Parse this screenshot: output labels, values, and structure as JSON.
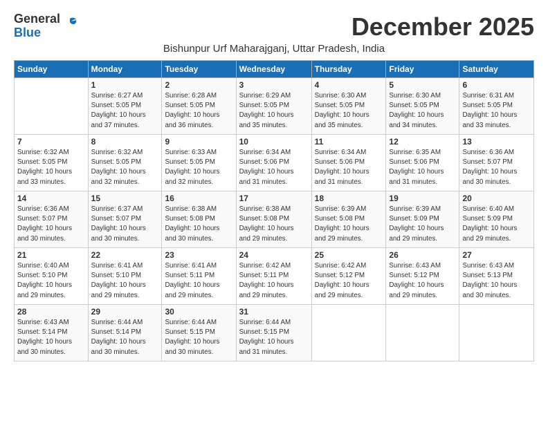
{
  "logo": {
    "general": "General",
    "blue": "Blue"
  },
  "title": "December 2025",
  "subtitle": "Bishunpur Urf Maharajganj, Uttar Pradesh, India",
  "days_header": [
    "Sunday",
    "Monday",
    "Tuesday",
    "Wednesday",
    "Thursday",
    "Friday",
    "Saturday"
  ],
  "weeks": [
    [
      {
        "num": "",
        "info": ""
      },
      {
        "num": "1",
        "info": "Sunrise: 6:27 AM\nSunset: 5:05 PM\nDaylight: 10 hours\nand 37 minutes."
      },
      {
        "num": "2",
        "info": "Sunrise: 6:28 AM\nSunset: 5:05 PM\nDaylight: 10 hours\nand 36 minutes."
      },
      {
        "num": "3",
        "info": "Sunrise: 6:29 AM\nSunset: 5:05 PM\nDaylight: 10 hours\nand 35 minutes."
      },
      {
        "num": "4",
        "info": "Sunrise: 6:30 AM\nSunset: 5:05 PM\nDaylight: 10 hours\nand 35 minutes."
      },
      {
        "num": "5",
        "info": "Sunrise: 6:30 AM\nSunset: 5:05 PM\nDaylight: 10 hours\nand 34 minutes."
      },
      {
        "num": "6",
        "info": "Sunrise: 6:31 AM\nSunset: 5:05 PM\nDaylight: 10 hours\nand 33 minutes."
      }
    ],
    [
      {
        "num": "7",
        "info": "Sunrise: 6:32 AM\nSunset: 5:05 PM\nDaylight: 10 hours\nand 33 minutes."
      },
      {
        "num": "8",
        "info": "Sunrise: 6:32 AM\nSunset: 5:05 PM\nDaylight: 10 hours\nand 32 minutes."
      },
      {
        "num": "9",
        "info": "Sunrise: 6:33 AM\nSunset: 5:05 PM\nDaylight: 10 hours\nand 32 minutes."
      },
      {
        "num": "10",
        "info": "Sunrise: 6:34 AM\nSunset: 5:06 PM\nDaylight: 10 hours\nand 31 minutes."
      },
      {
        "num": "11",
        "info": "Sunrise: 6:34 AM\nSunset: 5:06 PM\nDaylight: 10 hours\nand 31 minutes."
      },
      {
        "num": "12",
        "info": "Sunrise: 6:35 AM\nSunset: 5:06 PM\nDaylight: 10 hours\nand 31 minutes."
      },
      {
        "num": "13",
        "info": "Sunrise: 6:36 AM\nSunset: 5:07 PM\nDaylight: 10 hours\nand 30 minutes."
      }
    ],
    [
      {
        "num": "14",
        "info": "Sunrise: 6:36 AM\nSunset: 5:07 PM\nDaylight: 10 hours\nand 30 minutes."
      },
      {
        "num": "15",
        "info": "Sunrise: 6:37 AM\nSunset: 5:07 PM\nDaylight: 10 hours\nand 30 minutes."
      },
      {
        "num": "16",
        "info": "Sunrise: 6:38 AM\nSunset: 5:08 PM\nDaylight: 10 hours\nand 30 minutes."
      },
      {
        "num": "17",
        "info": "Sunrise: 6:38 AM\nSunset: 5:08 PM\nDaylight: 10 hours\nand 29 minutes."
      },
      {
        "num": "18",
        "info": "Sunrise: 6:39 AM\nSunset: 5:08 PM\nDaylight: 10 hours\nand 29 minutes."
      },
      {
        "num": "19",
        "info": "Sunrise: 6:39 AM\nSunset: 5:09 PM\nDaylight: 10 hours\nand 29 minutes."
      },
      {
        "num": "20",
        "info": "Sunrise: 6:40 AM\nSunset: 5:09 PM\nDaylight: 10 hours\nand 29 minutes."
      }
    ],
    [
      {
        "num": "21",
        "info": "Sunrise: 6:40 AM\nSunset: 5:10 PM\nDaylight: 10 hours\nand 29 minutes."
      },
      {
        "num": "22",
        "info": "Sunrise: 6:41 AM\nSunset: 5:10 PM\nDaylight: 10 hours\nand 29 minutes."
      },
      {
        "num": "23",
        "info": "Sunrise: 6:41 AM\nSunset: 5:11 PM\nDaylight: 10 hours\nand 29 minutes."
      },
      {
        "num": "24",
        "info": "Sunrise: 6:42 AM\nSunset: 5:11 PM\nDaylight: 10 hours\nand 29 minutes."
      },
      {
        "num": "25",
        "info": "Sunrise: 6:42 AM\nSunset: 5:12 PM\nDaylight: 10 hours\nand 29 minutes."
      },
      {
        "num": "26",
        "info": "Sunrise: 6:43 AM\nSunset: 5:12 PM\nDaylight: 10 hours\nand 29 minutes."
      },
      {
        "num": "27",
        "info": "Sunrise: 6:43 AM\nSunset: 5:13 PM\nDaylight: 10 hours\nand 30 minutes."
      }
    ],
    [
      {
        "num": "28",
        "info": "Sunrise: 6:43 AM\nSunset: 5:14 PM\nDaylight: 10 hours\nand 30 minutes."
      },
      {
        "num": "29",
        "info": "Sunrise: 6:44 AM\nSunset: 5:14 PM\nDaylight: 10 hours\nand 30 minutes."
      },
      {
        "num": "30",
        "info": "Sunrise: 6:44 AM\nSunset: 5:15 PM\nDaylight: 10 hours\nand 30 minutes."
      },
      {
        "num": "31",
        "info": "Sunrise: 6:44 AM\nSunset: 5:15 PM\nDaylight: 10 hours\nand 31 minutes."
      },
      {
        "num": "",
        "info": ""
      },
      {
        "num": "",
        "info": ""
      },
      {
        "num": "",
        "info": ""
      }
    ]
  ]
}
